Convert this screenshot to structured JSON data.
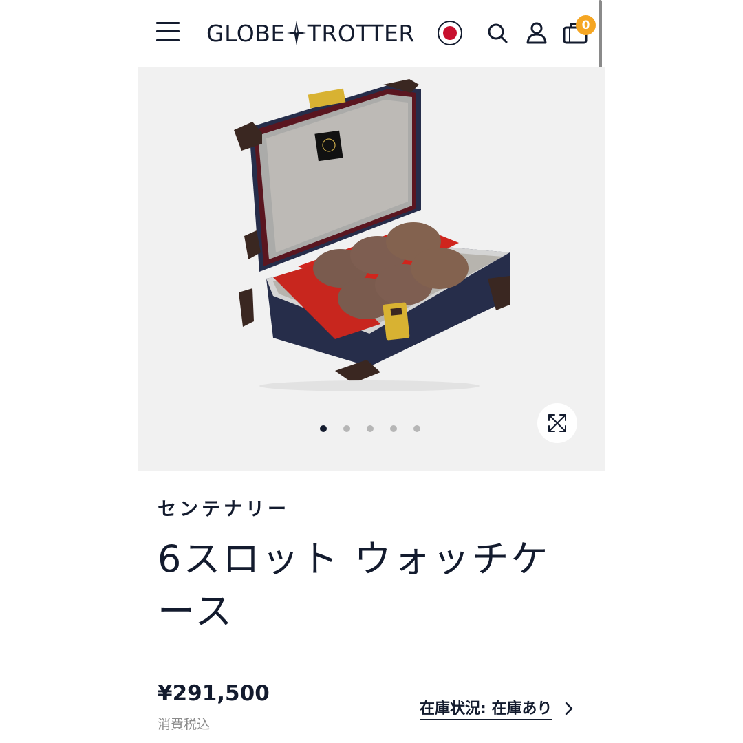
{
  "header": {
    "brand_left": "GLOBE",
    "brand_right": "TROTTER",
    "cart_count": "0",
    "colors": {
      "text": "#131b2e",
      "badge": "#f5a623",
      "flag_sun": "#c8102e"
    },
    "icons": [
      "menu-icon",
      "japan-flag-icon",
      "search-icon",
      "account-icon",
      "cart-icon"
    ]
  },
  "gallery": {
    "slide_count": 5,
    "active_slide": 1,
    "icons": [
      "expand-icon"
    ]
  },
  "product": {
    "collection": "センテナリー",
    "title": "6スロット ウォッチケース",
    "price": "¥291,500",
    "tax_note": "消費税込",
    "stock_label": "在庫状況: 在庫あり"
  }
}
